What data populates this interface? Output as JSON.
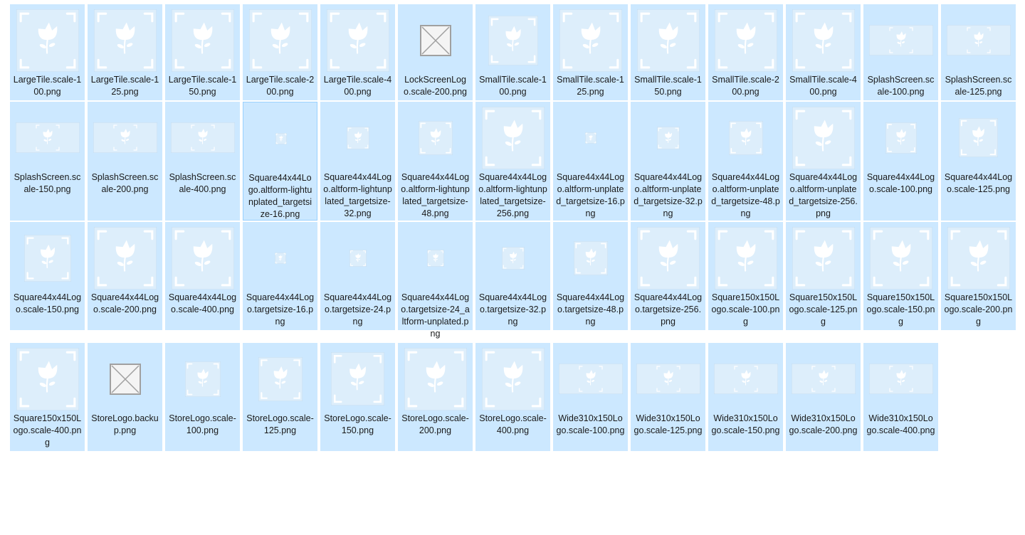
{
  "colors": {
    "selection_bg": "#cce8ff",
    "focus_border": "#99d1ff",
    "icon_bg": "#ddeefb",
    "icon_fg": "#ffffff",
    "text": "#1a1a1a"
  },
  "files": [
    {
      "name": "LargeTile.scale-100.png",
      "icon": "flower-tile-icon",
      "kind": "square",
      "s": 88
    },
    {
      "name": "LargeTile.scale-125.png",
      "icon": "flower-tile-icon",
      "kind": "square",
      "s": 88
    },
    {
      "name": "LargeTile.scale-150.png",
      "icon": "flower-tile-icon",
      "kind": "square",
      "s": 88
    },
    {
      "name": "LargeTile.scale-200.png",
      "icon": "flower-tile-icon",
      "kind": "square",
      "s": 88
    },
    {
      "name": "LargeTile.scale-400.png",
      "icon": "flower-tile-icon",
      "kind": "square",
      "s": 88
    },
    {
      "name": "LockScreenLogo.scale-200.png",
      "icon": "broken-image-icon",
      "kind": "broken",
      "s": 44
    },
    {
      "name": "SmallTile.scale-100.png",
      "icon": "flower-tile-icon",
      "kind": "square",
      "s": 70
    },
    {
      "name": "SmallTile.scale-125.png",
      "icon": "flower-tile-icon",
      "kind": "square",
      "s": 88
    },
    {
      "name": "SmallTile.scale-150.png",
      "icon": "flower-tile-icon",
      "kind": "square",
      "s": 88
    },
    {
      "name": "SmallTile.scale-200.png",
      "icon": "flower-tile-icon",
      "kind": "square",
      "s": 88
    },
    {
      "name": "SmallTile.scale-400.png",
      "icon": "flower-tile-icon",
      "kind": "square",
      "s": 88
    },
    {
      "name": "SplashScreen.scale-100.png",
      "icon": "flower-wide-icon",
      "kind": "wide",
      "s": 90
    },
    {
      "name": "SplashScreen.scale-125.png",
      "icon": "flower-wide-icon",
      "kind": "wide",
      "s": 90
    },
    {
      "name": "SplashScreen.scale-150.png",
      "icon": "flower-wide-icon",
      "kind": "wide",
      "s": 90
    },
    {
      "name": "SplashScreen.scale-200.png",
      "icon": "flower-wide-icon",
      "kind": "wide",
      "s": 90
    },
    {
      "name": "SplashScreen.scale-400.png",
      "icon": "flower-wide-icon",
      "kind": "wide",
      "s": 90
    },
    {
      "name": "Square44x44Logo.altform-lightunplated_targetsize-16.png",
      "icon": "flower-small-icon",
      "kind": "square",
      "s": 16,
      "focused": true
    },
    {
      "name": "Square44x44Logo.altform-lightunplated_targetsize-32.png",
      "icon": "flower-small-icon",
      "kind": "square",
      "s": 32
    },
    {
      "name": "Square44x44Logo.altform-lightunplated_targetsize-48.png",
      "icon": "flower-small-icon",
      "kind": "square",
      "s": 48
    },
    {
      "name": "Square44x44Logo.altform-lightunplated_targetsize-256.png",
      "icon": "flower-tile-icon",
      "kind": "square",
      "s": 88
    },
    {
      "name": "Square44x44Logo.altform-unplated_targetsize-16.png",
      "icon": "flower-small-icon",
      "kind": "square",
      "s": 16
    },
    {
      "name": "Square44x44Logo.altform-unplated_targetsize-32.png",
      "icon": "flower-small-icon",
      "kind": "square",
      "s": 32
    },
    {
      "name": "Square44x44Logo.altform-unplated_targetsize-48.png",
      "icon": "flower-small-icon",
      "kind": "square",
      "s": 48
    },
    {
      "name": "Square44x44Logo.altform-unplated_targetsize-256.png",
      "icon": "flower-tile-icon",
      "kind": "square",
      "s": 88
    },
    {
      "name": "Square44x44Logo.scale-100.png",
      "icon": "flower-small-icon",
      "kind": "square",
      "s": 44
    },
    {
      "name": "Square44x44Logo.scale-125.png",
      "icon": "flower-small-icon",
      "kind": "square",
      "s": 55
    },
    {
      "name": "Square44x44Logo.scale-150.png",
      "icon": "flower-small-icon",
      "kind": "square",
      "s": 66
    },
    {
      "name": "Square44x44Logo.scale-200.png",
      "icon": "flower-tile-icon",
      "kind": "square",
      "s": 88
    },
    {
      "name": "Square44x44Logo.scale-400.png",
      "icon": "flower-tile-icon",
      "kind": "square",
      "s": 88
    },
    {
      "name": "Square44x44Logo.targetsize-16.png",
      "icon": "flower-small-icon",
      "kind": "square",
      "s": 16
    },
    {
      "name": "Square44x44Logo.targetsize-24.png",
      "icon": "flower-small-icon",
      "kind": "square",
      "s": 24
    },
    {
      "name": "Square44x44Logo.targetsize-24_altform-unplated.png",
      "icon": "flower-small-icon",
      "kind": "square",
      "s": 24
    },
    {
      "name": "Square44x44Logo.targetsize-32.png",
      "icon": "flower-small-icon",
      "kind": "square",
      "s": 32
    },
    {
      "name": "Square44x44Logo.targetsize-48.png",
      "icon": "flower-small-icon",
      "kind": "square",
      "s": 48
    },
    {
      "name": "Square44x44Logo.targetsize-256.png",
      "icon": "flower-tile-icon",
      "kind": "square",
      "s": 88
    },
    {
      "name": "Square150x150Logo.scale-100.png",
      "icon": "flower-tile-icon",
      "kind": "square",
      "s": 88
    },
    {
      "name": "Square150x150Logo.scale-125.png",
      "icon": "flower-tile-icon",
      "kind": "square",
      "s": 88
    },
    {
      "name": "Square150x150Logo.scale-150.png",
      "icon": "flower-tile-icon",
      "kind": "square",
      "s": 88
    },
    {
      "name": "Square150x150Logo.scale-200.png",
      "icon": "flower-tile-icon",
      "kind": "square",
      "s": 88
    },
    {
      "name": "Square150x150Logo.scale-400.png",
      "icon": "flower-tile-icon",
      "kind": "square",
      "s": 88
    },
    {
      "name": "StoreLogo.backup.png",
      "icon": "broken-image-icon",
      "kind": "broken",
      "s": 44
    },
    {
      "name": "StoreLogo.scale-100.png",
      "icon": "flower-small-icon",
      "kind": "square",
      "s": 50
    },
    {
      "name": "StoreLogo.scale-125.png",
      "icon": "flower-small-icon",
      "kind": "square",
      "s": 62
    },
    {
      "name": "StoreLogo.scale-150.png",
      "icon": "flower-small-icon",
      "kind": "square",
      "s": 75
    },
    {
      "name": "StoreLogo.scale-200.png",
      "icon": "flower-tile-icon",
      "kind": "square",
      "s": 88
    },
    {
      "name": "StoreLogo.scale-400.png",
      "icon": "flower-tile-icon",
      "kind": "square",
      "s": 88
    },
    {
      "name": "Wide310x150Logo.scale-100.png",
      "icon": "flower-wide-icon",
      "kind": "wide",
      "s": 90
    },
    {
      "name": "Wide310x150Logo.scale-125.png",
      "icon": "flower-wide-icon",
      "kind": "wide",
      "s": 90
    },
    {
      "name": "Wide310x150Logo.scale-150.png",
      "icon": "flower-wide-icon",
      "kind": "wide",
      "s": 90
    },
    {
      "name": "Wide310x150Logo.scale-200.png",
      "icon": "flower-wide-icon",
      "kind": "wide",
      "s": 90
    },
    {
      "name": "Wide310x150Logo.scale-400.png",
      "icon": "flower-wide-icon",
      "kind": "wide",
      "s": 90
    }
  ]
}
